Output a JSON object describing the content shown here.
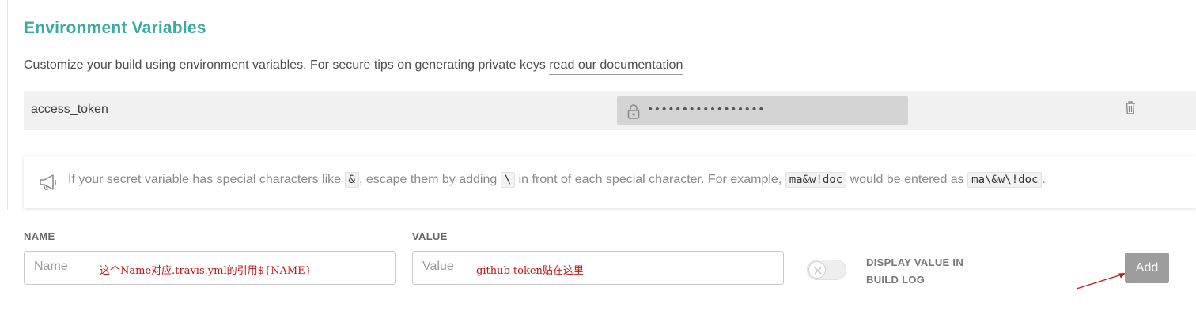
{
  "section": {
    "title": "Environment Variables",
    "description": "Customize your build using environment variables. For secure tips on generating private keys",
    "doc_link": "read our documentation"
  },
  "env_var": {
    "name": "access_token",
    "masked_value": "•••••••••••••••••"
  },
  "notice": {
    "part1": "If your secret variable has special characters like",
    "char_amp": "&",
    "part2": ", escape them by adding",
    "char_backslash": "\\",
    "part3": "in front of each special character. For example,",
    "example_raw": "ma&w!doc",
    "part4": "would be entered as",
    "example_escaped": "ma\\&w\\!doc",
    "part5": "."
  },
  "form": {
    "name_label": "NAME",
    "name_placeholder": "Name",
    "name_annotation": "这个Name对应.travis.yml的引用${NAME}",
    "value_label": "VALUE",
    "value_placeholder": "Value",
    "value_annotation": "github token贴在这里",
    "display_toggle_label_line1": "DISPLAY VALUE IN",
    "display_toggle_label_line2": "BUILD LOG",
    "add_button": "Add"
  },
  "colors": {
    "accent": "#39aaa4",
    "annotation": "#cc1111",
    "button": "#9d9d9d"
  }
}
